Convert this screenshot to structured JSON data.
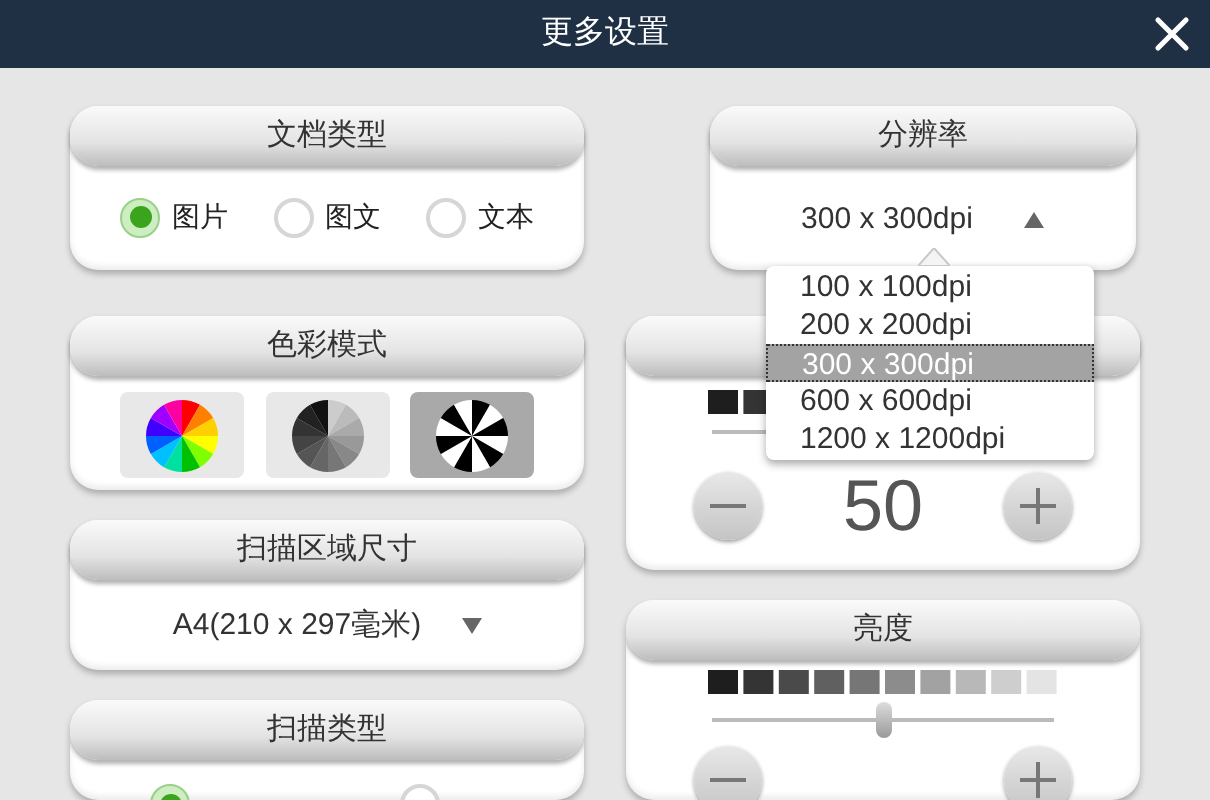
{
  "window": {
    "title": "更多设置"
  },
  "document_type": {
    "title": "文档类型",
    "options": [
      {
        "label": "图片",
        "selected": true
      },
      {
        "label": "图文",
        "selected": false
      },
      {
        "label": "文本",
        "selected": false
      }
    ]
  },
  "resolution": {
    "title": "分辨率",
    "value": "300 x 300dpi",
    "expanded": true,
    "options": [
      {
        "label": "100 x 100dpi",
        "selected": false
      },
      {
        "label": "200 x 200dpi",
        "selected": false
      },
      {
        "label": "300 x 300dpi",
        "selected": true
      },
      {
        "label": "600 x 600dpi",
        "selected": false
      },
      {
        "label": "1200 x 1200dpi",
        "selected": false
      }
    ]
  },
  "color_mode": {
    "title": "色彩模式",
    "options": [
      {
        "kind": "color",
        "selected": false
      },
      {
        "kind": "gray",
        "selected": false
      },
      {
        "kind": "bw",
        "selected": true
      }
    ]
  },
  "scan_area": {
    "title": "扫描区域尺寸",
    "value": "A4(210 x 297毫米)"
  },
  "contrast": {
    "value": "50"
  },
  "brightness": {
    "title": "亮度",
    "level": 0.5
  },
  "scan_type": {
    "title": "扫描类型",
    "options": [
      {
        "selected": true
      },
      {
        "selected": false
      }
    ]
  }
}
